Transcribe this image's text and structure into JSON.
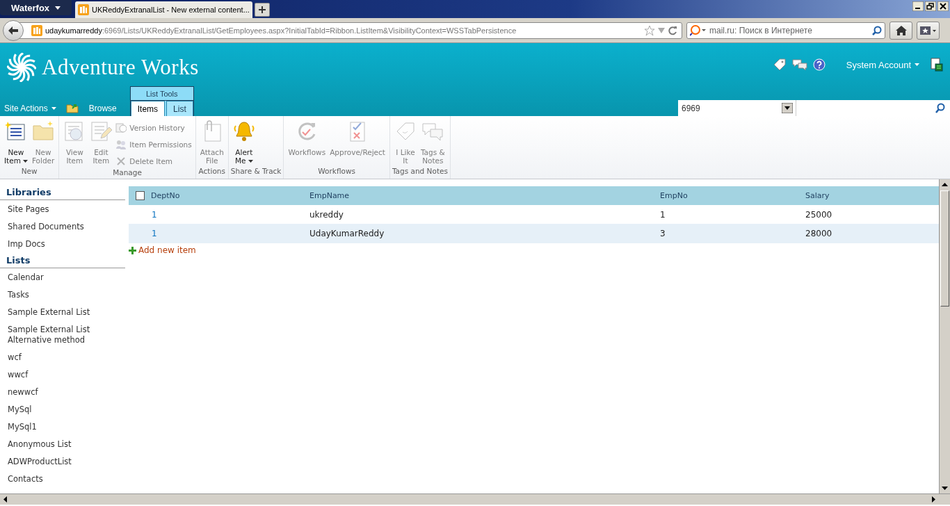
{
  "browser": {
    "app_button": "Waterfox",
    "tabs": [
      {
        "title": "UKReddyExtranalList - New external content...",
        "selected": true
      }
    ],
    "url_host": "udaykumarreddy",
    "url_rest": ":6969/Lists/UKReddyExtranalList/GetEmployees.aspx?InitialTabId=Ribbon.ListItem&VisibilityContext=WSSTabPersistence",
    "search_placeholder": "mail.ru: Поиск в Интернете"
  },
  "header": {
    "site_title": "Adventure Works",
    "user": "System Account",
    "site_actions": "Site Actions",
    "context_group": "List Tools",
    "search_scope": "6969",
    "tabs": [
      {
        "label": "Browse",
        "selected": false,
        "contextual": false
      },
      {
        "label": "Items",
        "selected": true,
        "contextual": true
      },
      {
        "label": "List",
        "selected": false,
        "contextual": true
      }
    ]
  },
  "ribbon": {
    "groups": [
      {
        "label": "New",
        "buttons": [
          {
            "kind": "large",
            "lines": [
              "New",
              "Item"
            ],
            "menu": true,
            "disabled": false
          },
          {
            "kind": "large",
            "lines": [
              "New",
              "Folder"
            ],
            "menu": false,
            "disabled": true
          }
        ]
      },
      {
        "label": "Manage",
        "buttons": [
          {
            "kind": "large",
            "lines": [
              "View",
              "Item"
            ],
            "menu": false,
            "disabled": true
          },
          {
            "kind": "large",
            "lines": [
              "Edit",
              "Item"
            ],
            "menu": false,
            "disabled": true
          },
          {
            "kind": "small",
            "lines": [
              "Version History"
            ],
            "menu": false,
            "disabled": true
          },
          {
            "kind": "small",
            "lines": [
              "Item Permissions"
            ],
            "menu": false,
            "disabled": true
          },
          {
            "kind": "small",
            "lines": [
              "Delete Item"
            ],
            "menu": false,
            "disabled": true
          }
        ]
      },
      {
        "label": "Actions",
        "buttons": [
          {
            "kind": "large",
            "lines": [
              "Attach",
              "File"
            ],
            "menu": false,
            "disabled": true
          }
        ]
      },
      {
        "label": "Share & Track",
        "buttons": [
          {
            "kind": "large",
            "lines": [
              "Alert",
              "Me"
            ],
            "menu": true,
            "disabled": false
          }
        ]
      },
      {
        "label": "Workflows",
        "buttons": [
          {
            "kind": "large",
            "lines": [
              "Workflows"
            ],
            "menu": false,
            "disabled": true
          },
          {
            "kind": "large",
            "lines": [
              "Approve/Reject"
            ],
            "menu": false,
            "disabled": true
          }
        ]
      },
      {
        "label": "Tags and Notes",
        "buttons": [
          {
            "kind": "large",
            "lines": [
              "I Like",
              "It"
            ],
            "menu": false,
            "disabled": true
          },
          {
            "kind": "large",
            "lines": [
              "Tags &",
              "Notes"
            ],
            "menu": false,
            "disabled": true
          }
        ]
      }
    ]
  },
  "nav": {
    "sections": [
      {
        "heading": "Libraries",
        "items": [
          "Site Pages",
          "Shared Documents",
          "Imp Docs"
        ]
      },
      {
        "heading": "Lists",
        "items": [
          "Calendar",
          "Tasks",
          "Sample External List",
          "Sample External List Alternative method",
          "wcf",
          "wwcf",
          "newwcf",
          "MySql",
          "MySql1",
          "Anonymous List",
          "ADWProductList",
          "Contacts"
        ]
      }
    ]
  },
  "list": {
    "select_all_checked": false,
    "columns": [
      "DeptNo",
      "EmpName",
      "EmpNo",
      "Salary"
    ],
    "rows": [
      [
        "1",
        "ukreddy",
        "1",
        "25000"
      ],
      [
        "1",
        "UdayKumarReddy",
        "3",
        "28000"
      ]
    ],
    "add_link": "Add new item"
  }
}
